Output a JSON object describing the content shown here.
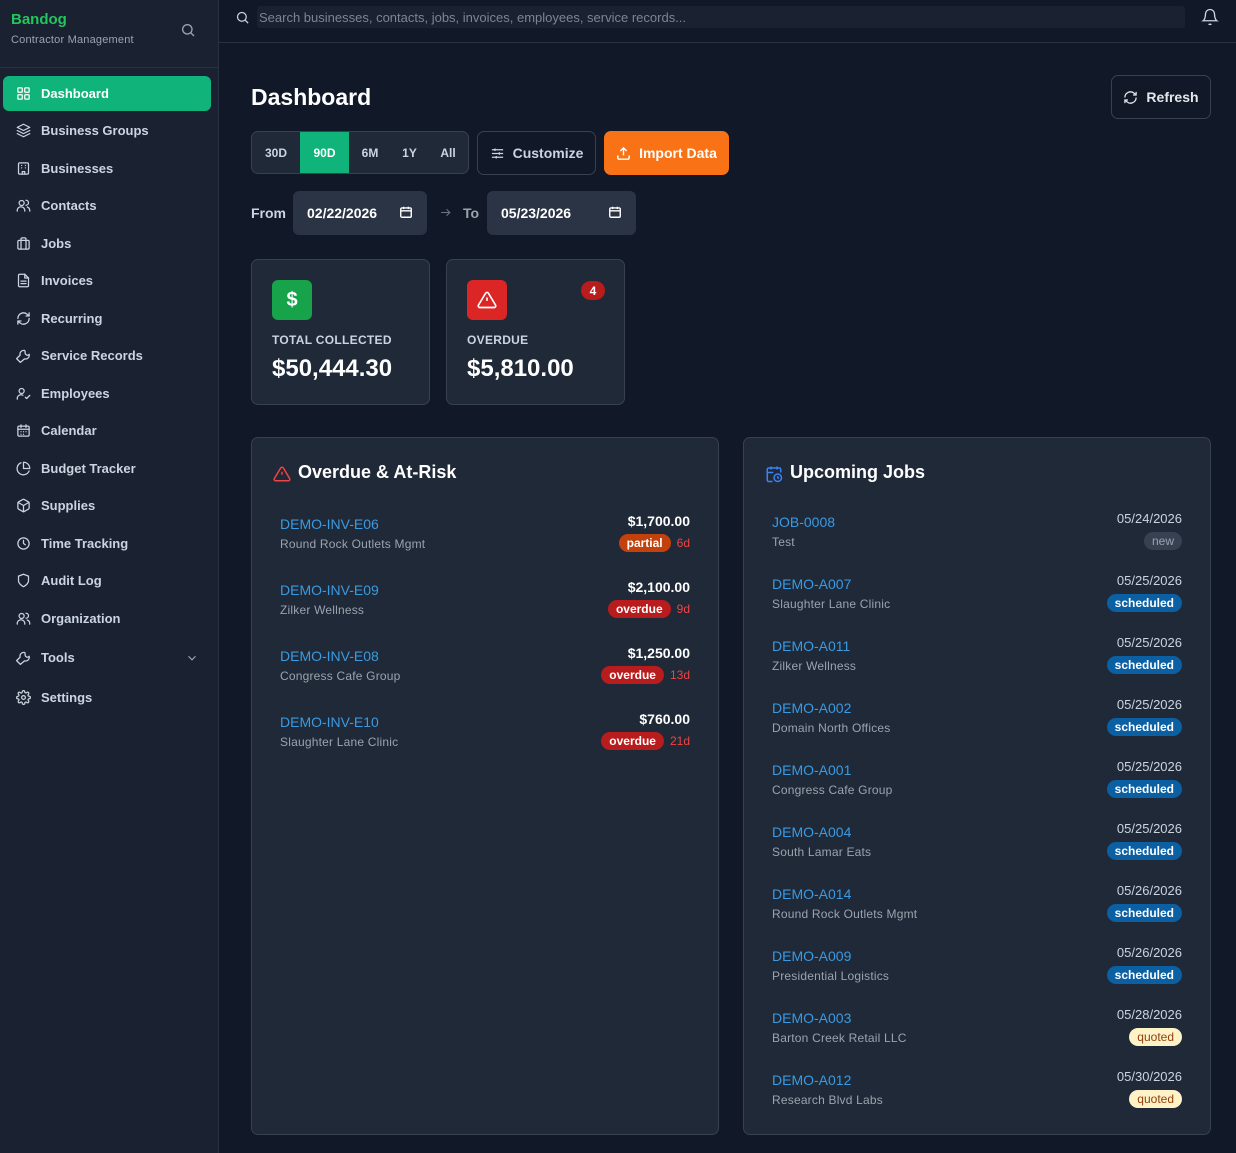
{
  "brand": {
    "name": "Bandog",
    "subtitle": "Contractor Management"
  },
  "sidebar": {
    "items": [
      {
        "label": "Dashboard",
        "icon": "grid-icon",
        "active": true
      },
      {
        "label": "Business Groups",
        "icon": "layers-icon"
      },
      {
        "label": "Businesses",
        "icon": "building-icon"
      },
      {
        "label": "Contacts",
        "icon": "users-icon"
      },
      {
        "label": "Jobs",
        "icon": "briefcase-icon"
      },
      {
        "label": "Invoices",
        "icon": "document-icon"
      },
      {
        "label": "Recurring",
        "icon": "refresh-icon"
      },
      {
        "label": "Service Records",
        "icon": "wrench-icon"
      },
      {
        "label": "Employees",
        "icon": "user-check-icon"
      },
      {
        "label": "Calendar",
        "icon": "calendar-icon"
      },
      {
        "label": "Budget Tracker",
        "icon": "pie-chart-icon"
      },
      {
        "label": "Supplies",
        "icon": "package-icon"
      },
      {
        "label": "Time Tracking",
        "icon": "clock-icon"
      },
      {
        "label": "Audit Log",
        "icon": "shield-icon"
      },
      {
        "label": "Organization",
        "icon": "users-icon"
      },
      {
        "label": "Tools",
        "icon": "wrench-icon",
        "expandable": true
      },
      {
        "label": "Settings",
        "icon": "gear-icon"
      }
    ]
  },
  "topbar": {
    "search_placeholder": "Search businesses, contacts, jobs, invoices, employees, service records..."
  },
  "page": {
    "title": "Dashboard",
    "refresh_label": "Refresh",
    "ranges": [
      "30D",
      "90D",
      "6M",
      "1Y",
      "All"
    ],
    "active_range": "90D",
    "customize_label": "Customize",
    "import_label": "Import Data",
    "from_label": "From",
    "to_label": "To",
    "from_date": "02/22/2026",
    "to_date": "05/23/2026"
  },
  "stats": {
    "collected": {
      "label": "TOTAL COLLECTED",
      "value": "$50,444.30",
      "icon": "dollar-icon"
    },
    "overdue": {
      "label": "OVERDUE",
      "value": "$5,810.00",
      "icon": "alert-triangle-icon",
      "badge": "4"
    }
  },
  "overdue_panel": {
    "title": "Overdue & At-Risk",
    "rows": [
      {
        "id": "DEMO-INV-E06",
        "client": "Round Rock Outlets Mgmt",
        "amount": "$1,700.00",
        "status": "partial",
        "days": "6d"
      },
      {
        "id": "DEMO-INV-E09",
        "client": "Zilker Wellness",
        "amount": "$2,100.00",
        "status": "overdue",
        "days": "9d"
      },
      {
        "id": "DEMO-INV-E08",
        "client": "Congress Cafe Group",
        "amount": "$1,250.00",
        "status": "overdue",
        "days": "13d"
      },
      {
        "id": "DEMO-INV-E10",
        "client": "Slaughter Lane Clinic",
        "amount": "$760.00",
        "status": "overdue",
        "days": "21d"
      }
    ]
  },
  "jobs_panel": {
    "title": "Upcoming Jobs",
    "rows": [
      {
        "id": "JOB-0008",
        "client": "Test",
        "date": "05/24/2026",
        "status": "new"
      },
      {
        "id": "DEMO-A007",
        "client": "Slaughter Lane Clinic",
        "date": "05/25/2026",
        "status": "scheduled"
      },
      {
        "id": "DEMO-A011",
        "client": "Zilker Wellness",
        "date": "05/25/2026",
        "status": "scheduled"
      },
      {
        "id": "DEMO-A002",
        "client": "Domain North Offices",
        "date": "05/25/2026",
        "status": "scheduled"
      },
      {
        "id": "DEMO-A001",
        "client": "Congress Cafe Group",
        "date": "05/25/2026",
        "status": "scheduled"
      },
      {
        "id": "DEMO-A004",
        "client": "South Lamar Eats",
        "date": "05/25/2026",
        "status": "scheduled"
      },
      {
        "id": "DEMO-A014",
        "client": "Round Rock Outlets Mgmt",
        "date": "05/26/2026",
        "status": "scheduled"
      },
      {
        "id": "DEMO-A009",
        "client": "Presidential Logistics",
        "date": "05/26/2026",
        "status": "scheduled"
      },
      {
        "id": "DEMO-A003",
        "client": "Barton Creek Retail LLC",
        "date": "05/28/2026",
        "status": "quoted"
      },
      {
        "id": "DEMO-A012",
        "client": "Research Blvd Labs",
        "date": "05/30/2026",
        "status": "quoted"
      }
    ]
  },
  "colors": {
    "accent": "#10b47a",
    "import": "#f97316",
    "link": "#3b9ae1",
    "danger": "#ef4444"
  }
}
